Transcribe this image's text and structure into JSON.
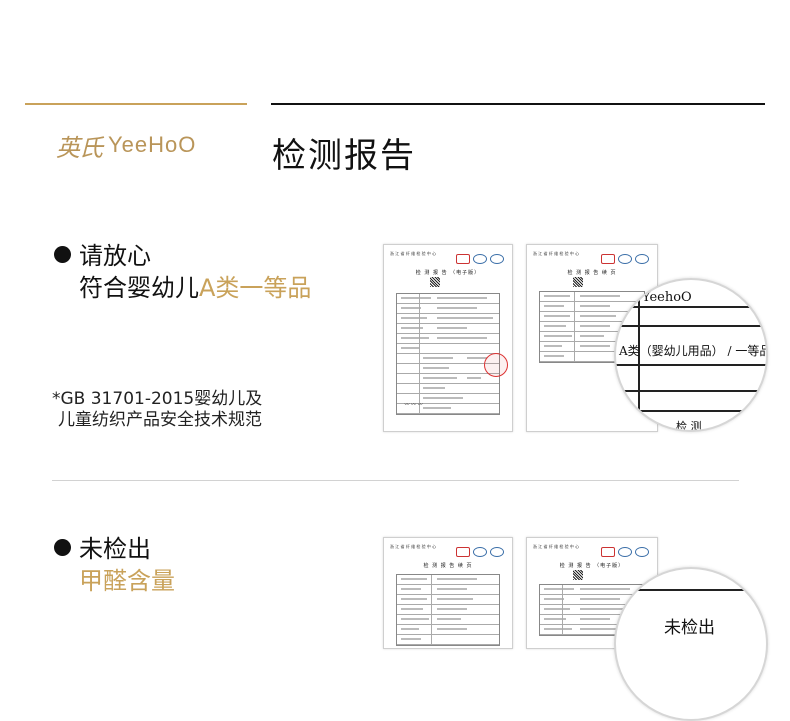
{
  "brand": {
    "logo_cn": "英氏",
    "logo_en": "YeeHoO"
  },
  "page_title": "检测报告",
  "sections": [
    {
      "heading_line1": "请放心",
      "heading_line2_prefix": "符合婴幼儿",
      "heading_line2_highlight": "A类一等品",
      "note_line1": "*GB 31701-2015婴幼儿及",
      "note_line2": "儿童纺织产品安全技术规范",
      "report1_title": "检 测 报 告",
      "report1_subtitle": "（电子版）",
      "report2_title": "检 测 报 告 续 页",
      "magnifier_brand": "YeehoO",
      "magnifier_text": "A类（婴幼儿用品） / 一等品",
      "magnifier_bottom": "检 测"
    },
    {
      "heading_line1": "未检出",
      "heading_line2_highlight": "甲醛含量",
      "report1_title": "检 测 报 告 续 页",
      "report2_title": "检 测 报 告",
      "report2_subtitle": "（电子版）",
      "magnifier_text": "未检出"
    }
  ],
  "report_header": "浙 江 省 纤 维 检 验 中 心",
  "colors": {
    "gold": "#c9a25a",
    "brand_gold": "#b99559",
    "dark": "#111111",
    "divider": "#d2d2d2"
  }
}
